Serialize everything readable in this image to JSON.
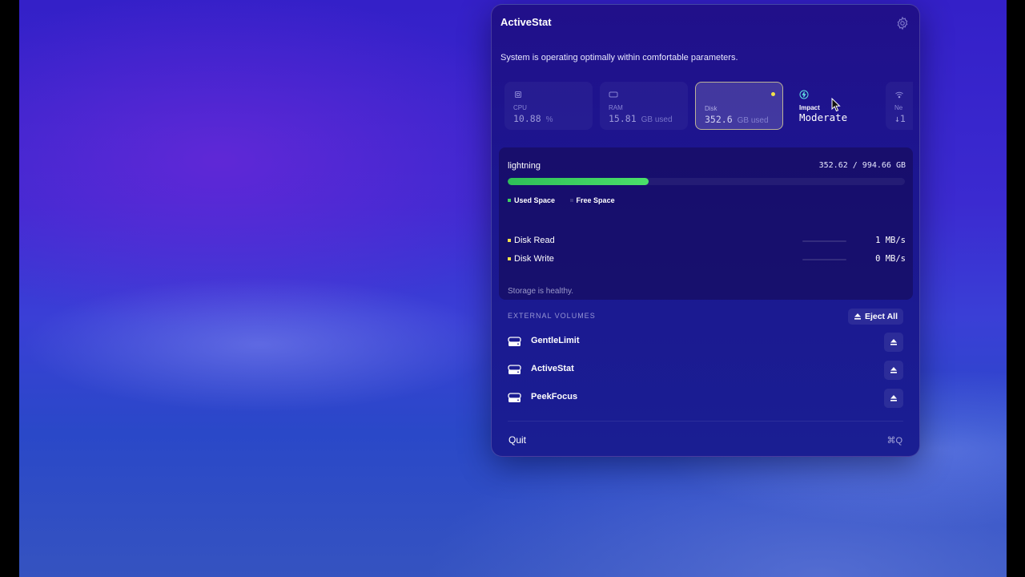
{
  "app": {
    "title": "ActiveStat",
    "status_message": "System is operating optimally within comfortable parameters."
  },
  "metrics": [
    {
      "label": "CPU",
      "value": "10.88",
      "unit": "%",
      "icon": "cpu-icon"
    },
    {
      "label": "RAM",
      "value": "15.81",
      "unit": "GB used",
      "icon": "memory-icon"
    },
    {
      "label": "Disk",
      "value": "352.6",
      "unit": "GB used",
      "icon": "disk-icon",
      "selected": true
    },
    {
      "label": "Impact",
      "value": "Moderate",
      "icon": "bolt-icon"
    },
    {
      "label": "Ne",
      "value": "↓1",
      "icon": "wifi-icon"
    }
  ],
  "disk": {
    "volume_name": "lightning",
    "usage_text": "352.62 / 994.66 GB",
    "used_fraction": 0.3545,
    "legend_used": "Used Space",
    "legend_free": "Free Space",
    "read_label": "Disk Read",
    "read_rate": "1 MB/s",
    "write_label": "Disk Write",
    "write_rate": "0 MB/s",
    "health": "Storage is healthy.",
    "colors": {
      "used": "#3fd160",
      "io_dot": "#f2e24a"
    }
  },
  "external": {
    "header": "EXTERNAL VOLUMES",
    "eject_all": "Eject All",
    "volumes": [
      "GentleLimit",
      "ActiveStat",
      "PeekFocus"
    ]
  },
  "footer": {
    "quit": "Quit",
    "shortcut": "⌘Q"
  }
}
